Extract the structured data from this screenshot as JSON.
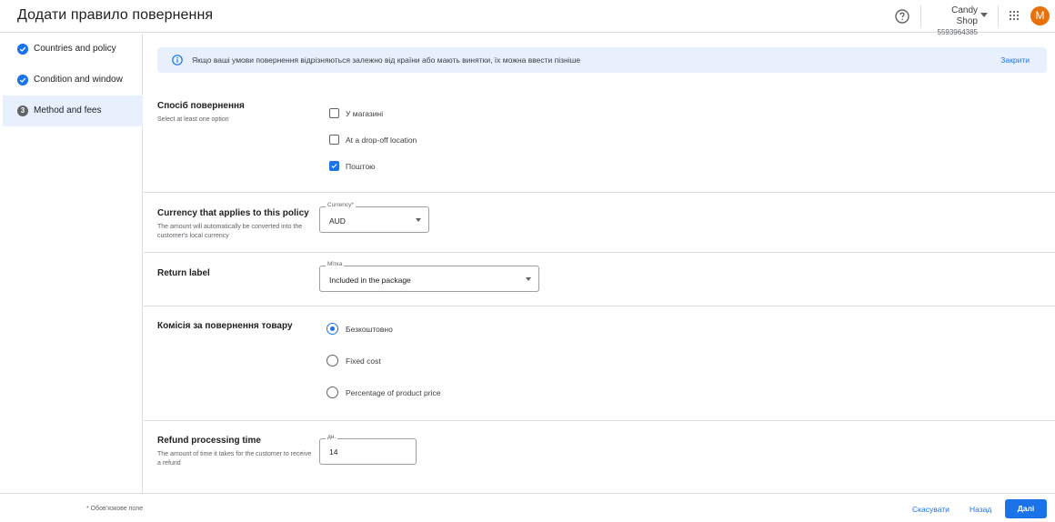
{
  "header": {
    "title": "Додати правило повернення",
    "account_name": "Candy Shop",
    "account_id": "5593964385",
    "avatar_letter": "M"
  },
  "sidebar": {
    "steps": [
      {
        "label": "Countries and policy",
        "state": "done"
      },
      {
        "label": "Condition and window",
        "state": "done"
      },
      {
        "label": "Method and fees",
        "state": "active",
        "number": "3"
      }
    ]
  },
  "banner": {
    "message": "Якщо ваші умови повернення відрізняються залежно від країни або мають винятки, їх можна ввести пізніше",
    "close_label": "Закрити"
  },
  "return_method": {
    "title": "Спосіб повернення",
    "description": "Select at least one option",
    "options": [
      {
        "label": "У магазині",
        "checked": false
      },
      {
        "label": "At a drop-off location",
        "checked": false
      },
      {
        "label": "Поштою",
        "checked": true
      }
    ]
  },
  "currency": {
    "title": "Currency that applies to this policy",
    "description": "The amount will automatically be converted into the customer's local currency",
    "field_label": "Currency*",
    "value": "AUD"
  },
  "return_label": {
    "title": "Return label",
    "field_label": "Мітка",
    "value": "Included in the package"
  },
  "return_fee": {
    "title": "Комісія за повернення товару",
    "options": [
      {
        "label": "Безкоштовно",
        "selected": true
      },
      {
        "label": "Fixed cost",
        "selected": false
      },
      {
        "label": "Percentage of product price",
        "selected": false
      }
    ]
  },
  "refund_time": {
    "title": "Refund processing time",
    "description": "The amount of time it takes for the customer to receive a refund",
    "field_label": "дн.",
    "value": "14"
  },
  "footer": {
    "required_note": "* Обов'язкове поле",
    "cancel_label": "Скасувати",
    "back_label": "Назад",
    "next_label": "Далі"
  },
  "colors": {
    "accent": "#1a73e8",
    "avatar": "#e8710a",
    "banner_bg": "#e8f0fe"
  }
}
